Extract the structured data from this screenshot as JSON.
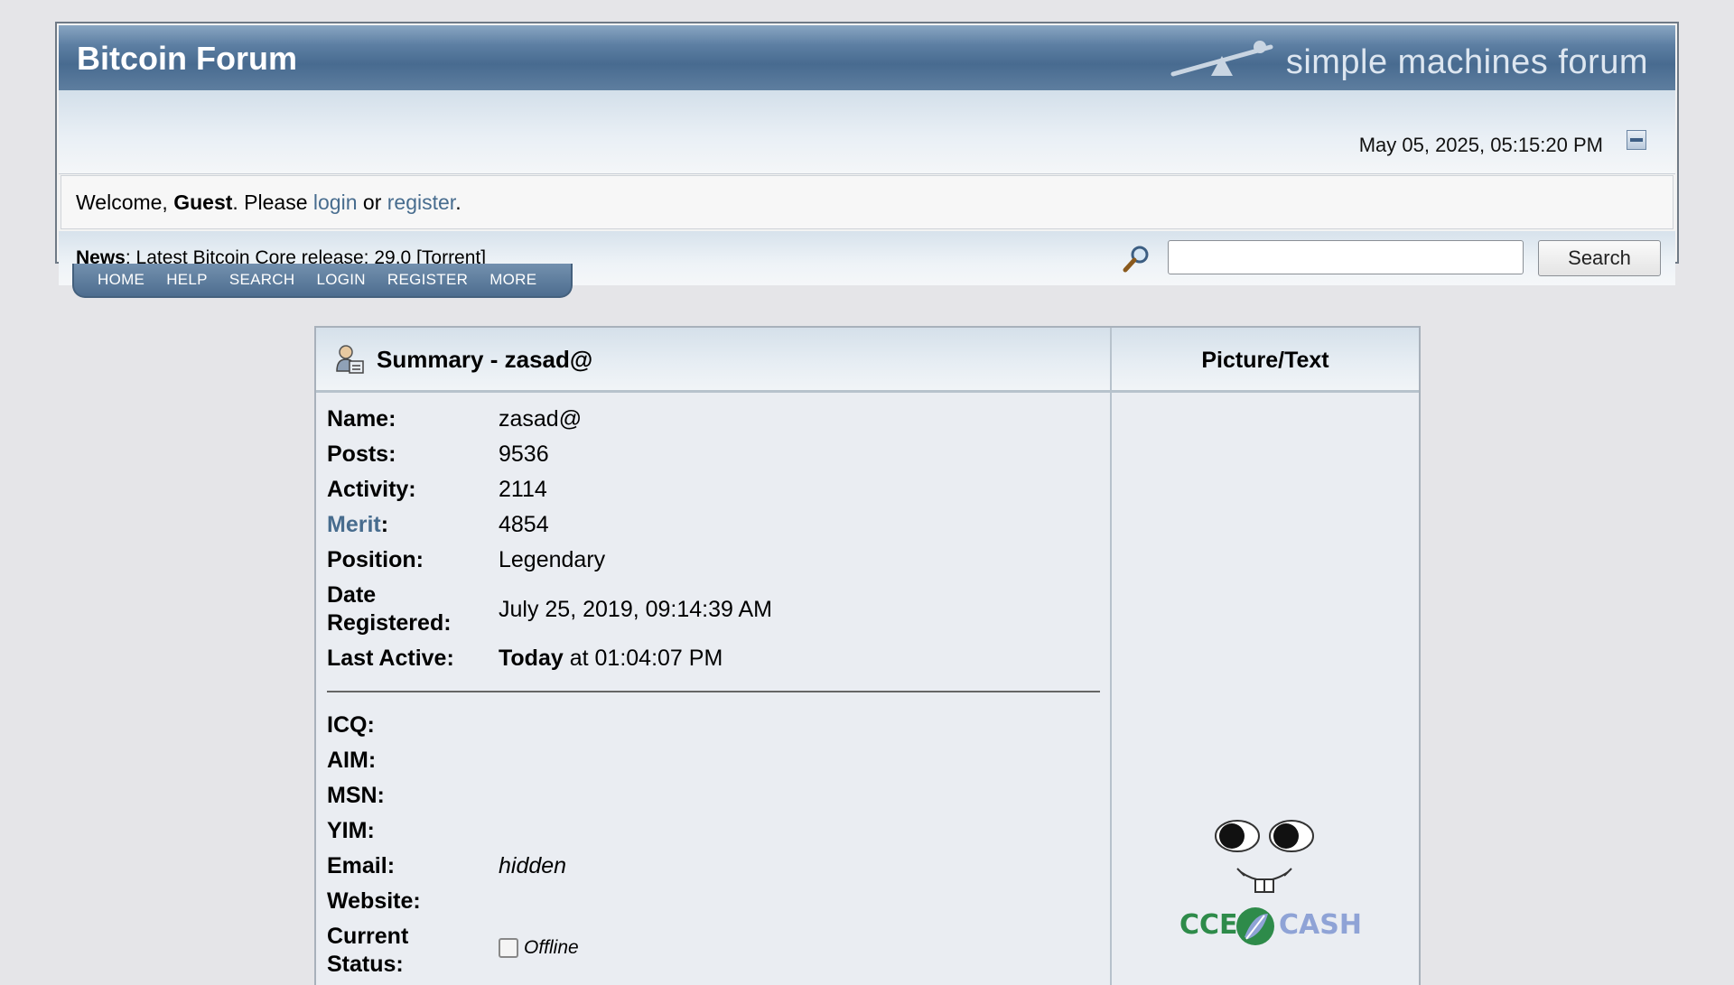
{
  "header": {
    "forum_title": "Bitcoin Forum",
    "logo_text": "simple machines forum",
    "datetime": "May 05, 2025, 05:15:20 PM"
  },
  "welcome": {
    "prefix": "Welcome, ",
    "user": "Guest",
    "middle": ". Please ",
    "login_label": "login",
    "or": " or ",
    "register_label": "register",
    "suffix": "."
  },
  "news": {
    "label": "News",
    "text": ": Latest Bitcoin Core release: ",
    "version_link": "29.0",
    "torrent_open": " [",
    "torrent_link": "Torrent",
    "torrent_close": "]"
  },
  "search": {
    "placeholder": "",
    "button_label": "Search"
  },
  "nav": {
    "items": [
      "HOME",
      "HELP",
      "SEARCH",
      "LOGIN",
      "REGISTER",
      "MORE"
    ]
  },
  "profile": {
    "summary_title": "Summary - zasad@",
    "picture_header": "Picture/Text",
    "fields": {
      "name_label": "Name:",
      "name_value": "zasad@",
      "posts_label": "Posts:",
      "posts_value": "9536",
      "activity_label": "Activity:",
      "activity_value": "2114",
      "merit_link": "Merit",
      "merit_colon": ":",
      "merit_value": "4854",
      "position_label": "Position:",
      "position_value": "Legendary",
      "date_label_1": "Date",
      "date_label_2": "Registered:",
      "date_value": "July 25, 2019, 09:14:39 AM",
      "last_active_label": "Last Active:",
      "last_active_today": "Today",
      "last_active_rest": " at 01:04:07 PM",
      "icq_label": "ICQ:",
      "aim_label": "AIM:",
      "msn_label": "MSN:",
      "yim_label": "YIM:",
      "email_label": "Email:",
      "email_value": "hidden",
      "website_label": "Website:",
      "status_label_1": "Current",
      "status_label_2": "Status:",
      "status_value": "Offline"
    },
    "avatar_text_left": "CCE",
    "avatar_text_right": "CASH"
  },
  "colors": {
    "header_blue": "#486b90",
    "link": "#476c8e",
    "avatar_green": "#2e8b4a",
    "avatar_blue": "#8fa3d6"
  }
}
